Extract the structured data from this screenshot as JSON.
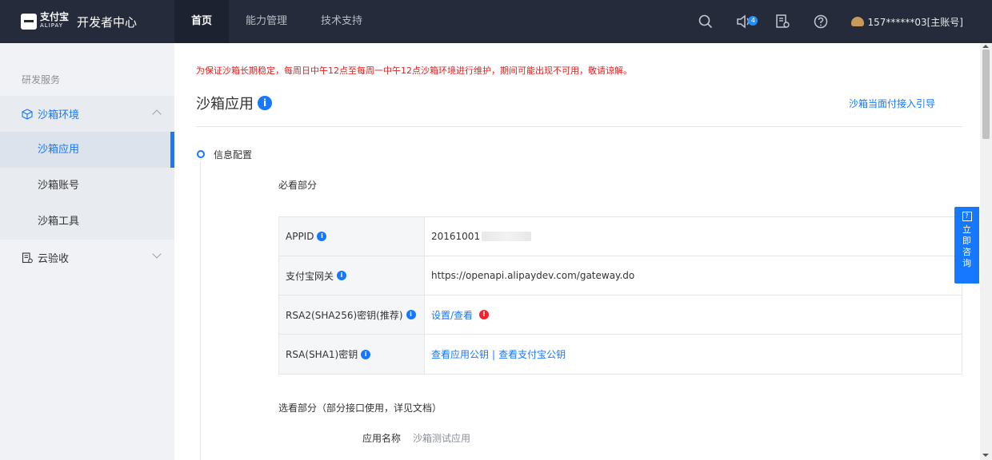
{
  "header": {
    "logo_cn": "支付宝",
    "logo_en": "ALIPAY",
    "title": "开发者中心",
    "nav": [
      {
        "label": "首页",
        "active": true
      },
      {
        "label": "能力管理",
        "active": false
      },
      {
        "label": "技术支持",
        "active": false
      }
    ],
    "notification_count": "4",
    "user": "157******03[主账号]"
  },
  "sidebar": {
    "group": "研发服务",
    "sandbox_label": "沙箱环境",
    "children": [
      "沙箱应用",
      "沙箱账号",
      "沙箱工具"
    ],
    "cloud_label": "云验收"
  },
  "main": {
    "notice": "为保证沙箱长期稳定，每周日中午12点至每周一中午12点沙箱环境进行维护，期间可能出现不可用，敬请谅解。",
    "title": "沙箱应用",
    "guide_link": "沙箱当面付接入引导",
    "step_label": "信息配置",
    "must_section": "必看部分",
    "rows": {
      "appid_label": "APPID",
      "appid_value": "20161001",
      "gateway_label": "支付宝网关",
      "gateway_value": "https://openapi.alipaydev.com/gateway.do",
      "rsa2_label": "RSA2(SHA256)密钥(推荐)",
      "rsa2_link": "设置/查看",
      "rsa_label": "RSA(SHA1)密钥",
      "rsa_link_app": "查看应用公钥",
      "rsa_link_sep": "|",
      "rsa_link_alipay": "查看支付宝公钥"
    },
    "optional_section": "选看部分（部分接口使用，详见文档）",
    "app_name_label": "应用名称",
    "app_name_value": "沙箱测试应用"
  },
  "consult": {
    "q": "?",
    "chars": [
      "立",
      "即",
      "咨",
      "询"
    ]
  },
  "icons": {
    "info": "i",
    "warn": "!"
  },
  "colors": {
    "topbar": "#252b3b",
    "accent": "#1677ff",
    "warning": "#f5222d",
    "notice": "#e02020"
  }
}
